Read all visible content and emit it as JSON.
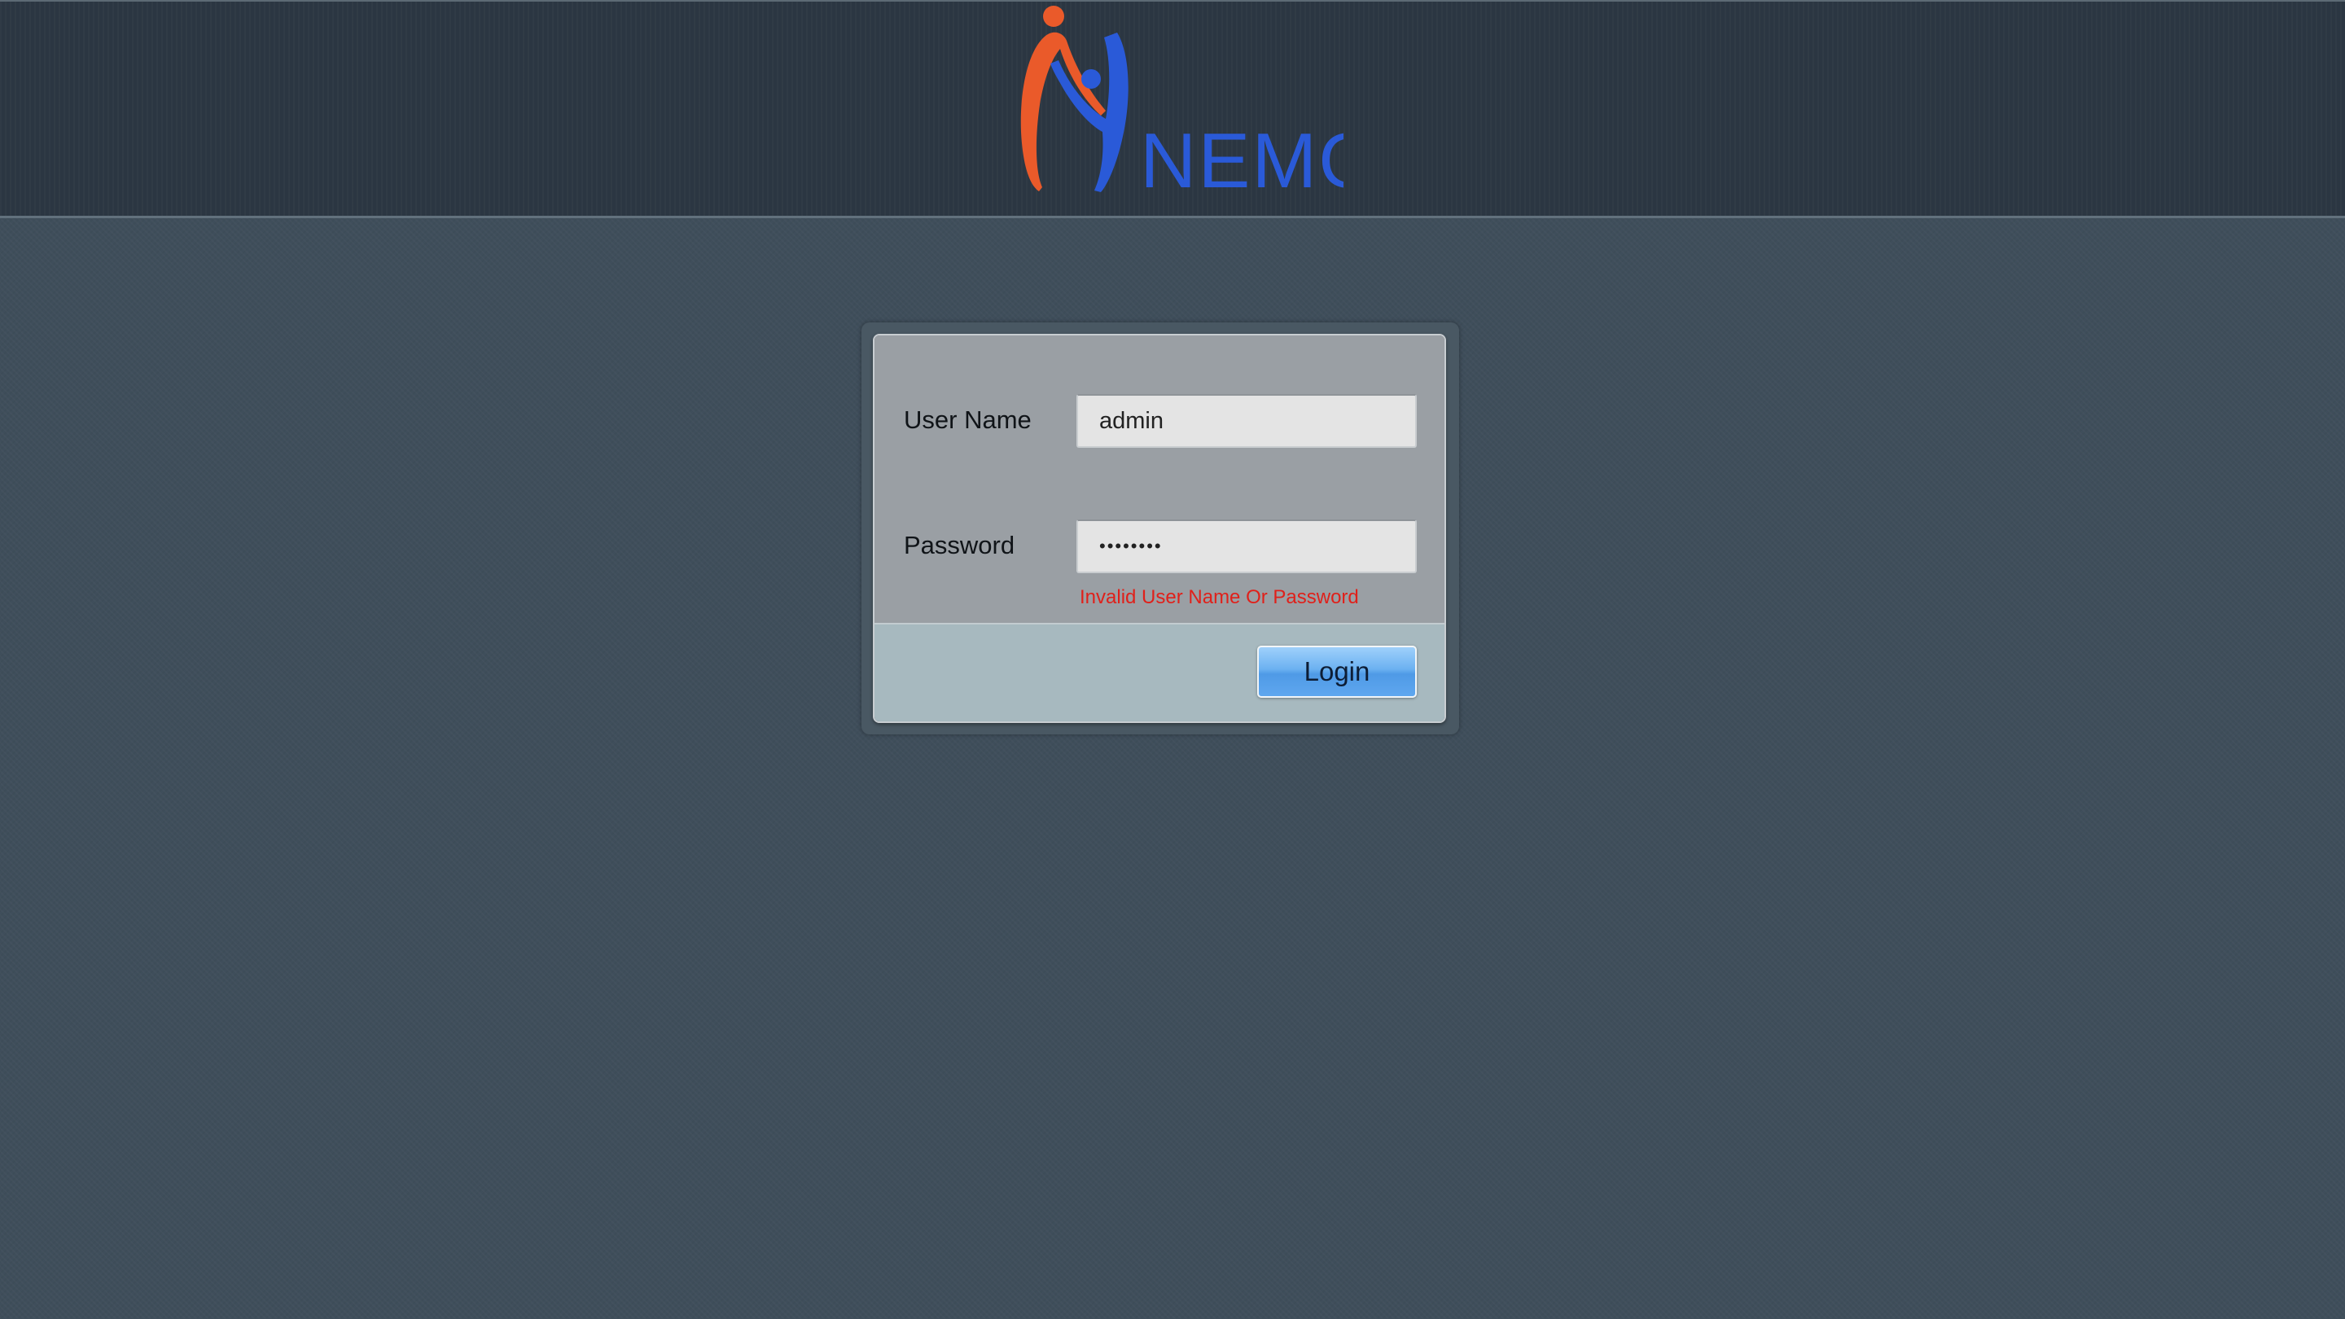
{
  "header": {
    "logo_icon": "nemo-logo-icon",
    "logo_text": "NEMO",
    "colors": {
      "logo_orange": "#ea5a2a",
      "logo_blue": "#2a5ad8"
    }
  },
  "login": {
    "username_label": "User Name",
    "username_value": "admin",
    "password_label": "Password",
    "password_value": "••••••••",
    "error_message": "Invalid User Name Or Password",
    "login_button": "Login",
    "colors": {
      "error": "#e0201a",
      "button": "#5fa7ef"
    }
  }
}
